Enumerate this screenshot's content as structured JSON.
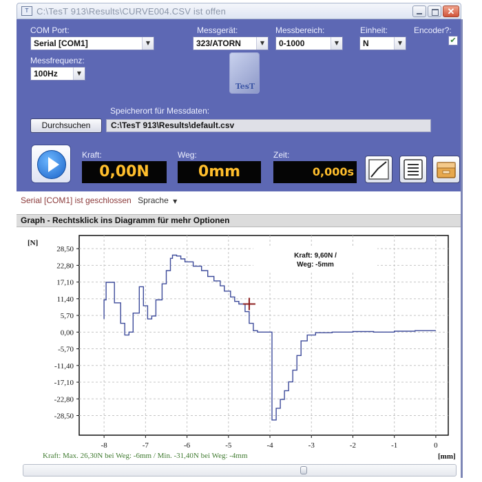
{
  "window": {
    "title": "C:\\TesT 913\\Results\\CURVE004.CSV  ist offen",
    "app_icon_glyph": "T"
  },
  "settings": {
    "com_port": {
      "label": "COM Port:",
      "value": "Serial [COM1]"
    },
    "messgeraet": {
      "label": "Messgerät:",
      "value": "323/ATORN"
    },
    "messbereich": {
      "label": "Messbereich:",
      "value": "0-1000"
    },
    "einheit": {
      "label": "Einheit:",
      "value": "N"
    },
    "encoder": {
      "label": "Encoder?:",
      "checked": true
    },
    "messfrequenz": {
      "label": "Messfrequenz:",
      "value": "100Hz"
    }
  },
  "logo_text": "TesT",
  "storage": {
    "label": "Speicherort für Messdaten:",
    "browse_label": "Durchsuchen",
    "path": "C:\\TesT 913\\Results\\default.csv"
  },
  "readouts": {
    "kraft": {
      "label": "Kraft:",
      "value": "0,00N"
    },
    "weg": {
      "label": "Weg:",
      "value": "0mm"
    },
    "zeit": {
      "label": "Zeit:",
      "value": "0,000s"
    }
  },
  "status": {
    "text": "Serial [COM1] ist geschlossen",
    "language_menu": "Sprache"
  },
  "graph": {
    "header": "Graph - Rechtsklick ins Diagramm für mehr Optionen",
    "footer": "Kraft: Max. 26,30N bei Weg: -6mm / Min. -31,40N bei Weg: -4mm"
  },
  "colors": {
    "panel": "#5d68b4",
    "display_text": "#ffbe2c",
    "curve": "#3c4a9a",
    "cursor": "#8b1a1a"
  },
  "chart_data": {
    "type": "line",
    "ylabel": "[N]",
    "xlabel": "[mm]",
    "xlim": [
      -8.6,
      0.3
    ],
    "ylim": [
      -35.2,
      33.0
    ],
    "yticks": [
      "28,50",
      "22,80",
      "17,10",
      "11,40",
      "5,70",
      "0,00",
      "-5,70",
      "-11,40",
      "-17,10",
      "-22,80",
      "-28,50"
    ],
    "ytick_values": [
      28.5,
      22.8,
      17.1,
      11.4,
      5.7,
      0.0,
      -5.7,
      -11.4,
      -17.1,
      -22.8,
      -28.5
    ],
    "xticks": [
      "-8",
      "-7",
      "-6",
      "-5",
      "-4",
      "-3",
      "-2",
      "-1",
      "0"
    ],
    "xtick_values": [
      -8,
      -7,
      -6,
      -5,
      -4,
      -3,
      -2,
      -1,
      0
    ],
    "grid": true,
    "annotation": {
      "line1": "Kraft: 9,60N /",
      "line2": "Weg: -5mm"
    },
    "cursor": {
      "x": -4.5,
      "y": 9.6
    },
    "series": [
      {
        "x": [
          -8.0,
          -8.0,
          -7.95,
          -7.95,
          -7.75,
          -7.75,
          -7.6,
          -7.6,
          -7.5,
          -7.5,
          -7.4,
          -7.4,
          -7.3,
          -7.3,
          -7.15,
          -7.15,
          -7.05,
          -7.05,
          -6.95,
          -6.95,
          -6.85,
          -6.85,
          -6.75,
          -6.75,
          -6.6,
          -6.6,
          -6.5,
          -6.5,
          -6.4,
          -6.4,
          -6.35,
          -6.35,
          -6.25,
          -6.25,
          -6.15,
          -6.15,
          -6.05,
          -6.05,
          -5.85,
          -5.85,
          -5.65,
          -5.65,
          -5.5,
          -5.5,
          -5.35,
          -5.35,
          -5.2,
          -5.2,
          -5.1,
          -5.1,
          -4.95,
          -4.95,
          -4.85,
          -4.85,
          -4.75,
          -4.75,
          -4.6,
          -4.6,
          -4.5,
          -4.5,
          -4.4,
          -4.4,
          -4.3,
          -4.3,
          -4.2,
          -4.2,
          -3.95,
          -3.95,
          -3.85,
          -3.85,
          -3.75,
          -3.75,
          -3.65,
          -3.65,
          -3.55,
          -3.55,
          -3.45,
          -3.45,
          -3.35,
          -3.35,
          -3.25,
          -3.25,
          -3.1,
          -3.1,
          -2.9,
          -2.9,
          -2.5,
          -2.5,
          -2.0,
          -2.0,
          -1.5,
          -1.5,
          -1.0,
          -1.0,
          -0.5,
          -0.5,
          0.0
        ],
        "y": [
          4.5,
          11.0,
          11.0,
          17.0,
          17.0,
          10.0,
          10.0,
          3.0,
          3.0,
          -1.0,
          -1.0,
          0.0,
          0.0,
          6.5,
          6.5,
          15.5,
          15.5,
          9.0,
          9.0,
          4.5,
          4.5,
          5.5,
          5.5,
          11.0,
          11.0,
          16.5,
          16.5,
          21.0,
          21.0,
          25.2,
          25.2,
          26.3,
          26.3,
          26.0,
          26.0,
          25.0,
          25.0,
          24.0,
          24.0,
          22.5,
          22.5,
          21.0,
          21.0,
          19.0,
          19.0,
          17.5,
          17.5,
          15.8,
          15.8,
          14.0,
          14.0,
          12.0,
          12.0,
          10.5,
          10.5,
          9.6,
          9.6,
          7.0,
          7.0,
          3.0,
          3.0,
          0.5,
          0.5,
          0.0,
          0.0,
          0.0,
          0.0,
          -30.0,
          -30.0,
          -26.0,
          -26.0,
          -23.0,
          -23.0,
          -20.0,
          -20.0,
          -17.0,
          -17.0,
          -13.0,
          -13.0,
          -8.0,
          -8.0,
          -3.0,
          -3.0,
          -1.0,
          -1.0,
          -0.2,
          -0.2,
          0.0,
          0.0,
          0.2,
          0.2,
          0.0,
          0.0,
          0.3,
          0.3,
          0.5,
          0.5
        ]
      }
    ]
  }
}
